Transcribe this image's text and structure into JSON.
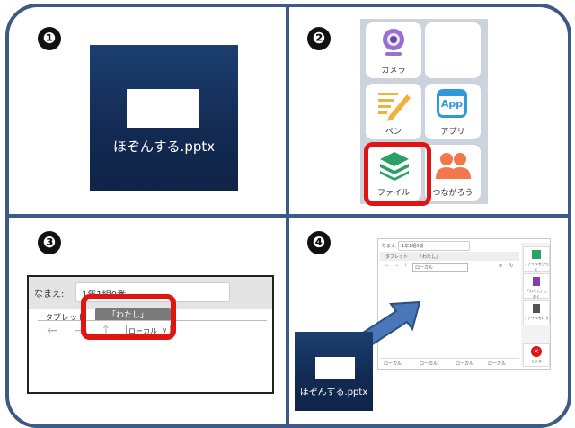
{
  "steps": {
    "step1": "❶",
    "step2": "❷",
    "step3": "❸",
    "step4": "❹"
  },
  "panel1": {
    "file_name": "ほぞんする.pptx"
  },
  "panel2": {
    "cells": [
      {
        "label": "カメラ",
        "icon": "camera-icon"
      },
      {
        "label": "",
        "icon": ""
      },
      {
        "label": "ペン",
        "icon": "pen-icon"
      },
      {
        "label": "アプリ",
        "icon": "app-icon",
        "icon_text": "App"
      },
      {
        "label": "ファイル",
        "icon": "file-stack-icon"
      },
      {
        "label": "つながろう",
        "icon": "people-icon"
      }
    ]
  },
  "panel3": {
    "name_label": "なまえ:",
    "name_value": "1年1組0番",
    "tab_tablet": "タブレット",
    "tab_mine": "「わたし」",
    "location": "ローカル",
    "location_arrow": "∨"
  },
  "panel4": {
    "name_label": "なまえ:",
    "name_value": "1年1組0番",
    "tab_tablet": "タブレット",
    "tab_mine": "「わたし」",
    "path_text": "ローカル",
    "side_buttons": [
      "ファイルをひらく",
      "「わたし」に おく",
      "ファイルをけす",
      "とじる"
    ],
    "footer_items": [
      "ローカル",
      "ローカル",
      "ローカル",
      "ローカル"
    ],
    "file_name": "ほぞんする.pptx"
  },
  "colors": {
    "frame": "#3d5a84",
    "highlight": "#e11414",
    "file_tile": "#15315c"
  }
}
